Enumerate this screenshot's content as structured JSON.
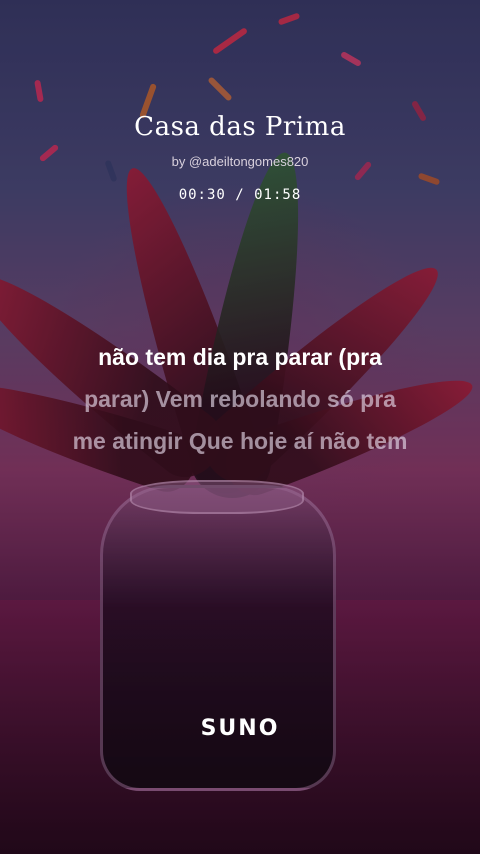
{
  "song": {
    "title": "Casa das Prima",
    "byline": "by @adeiltongomes820",
    "time": "00:30 / 01:58"
  },
  "lyrics": {
    "line1": "não tem dia pra parar (pra",
    "line2": "parar) Vem rebolando só pra",
    "line3": "me atingir Que hoje aí não tem"
  },
  "brand": {
    "logo": "SUNO"
  },
  "colors": {
    "text": "#ffffff",
    "dim_text": "#ebe1f0"
  }
}
